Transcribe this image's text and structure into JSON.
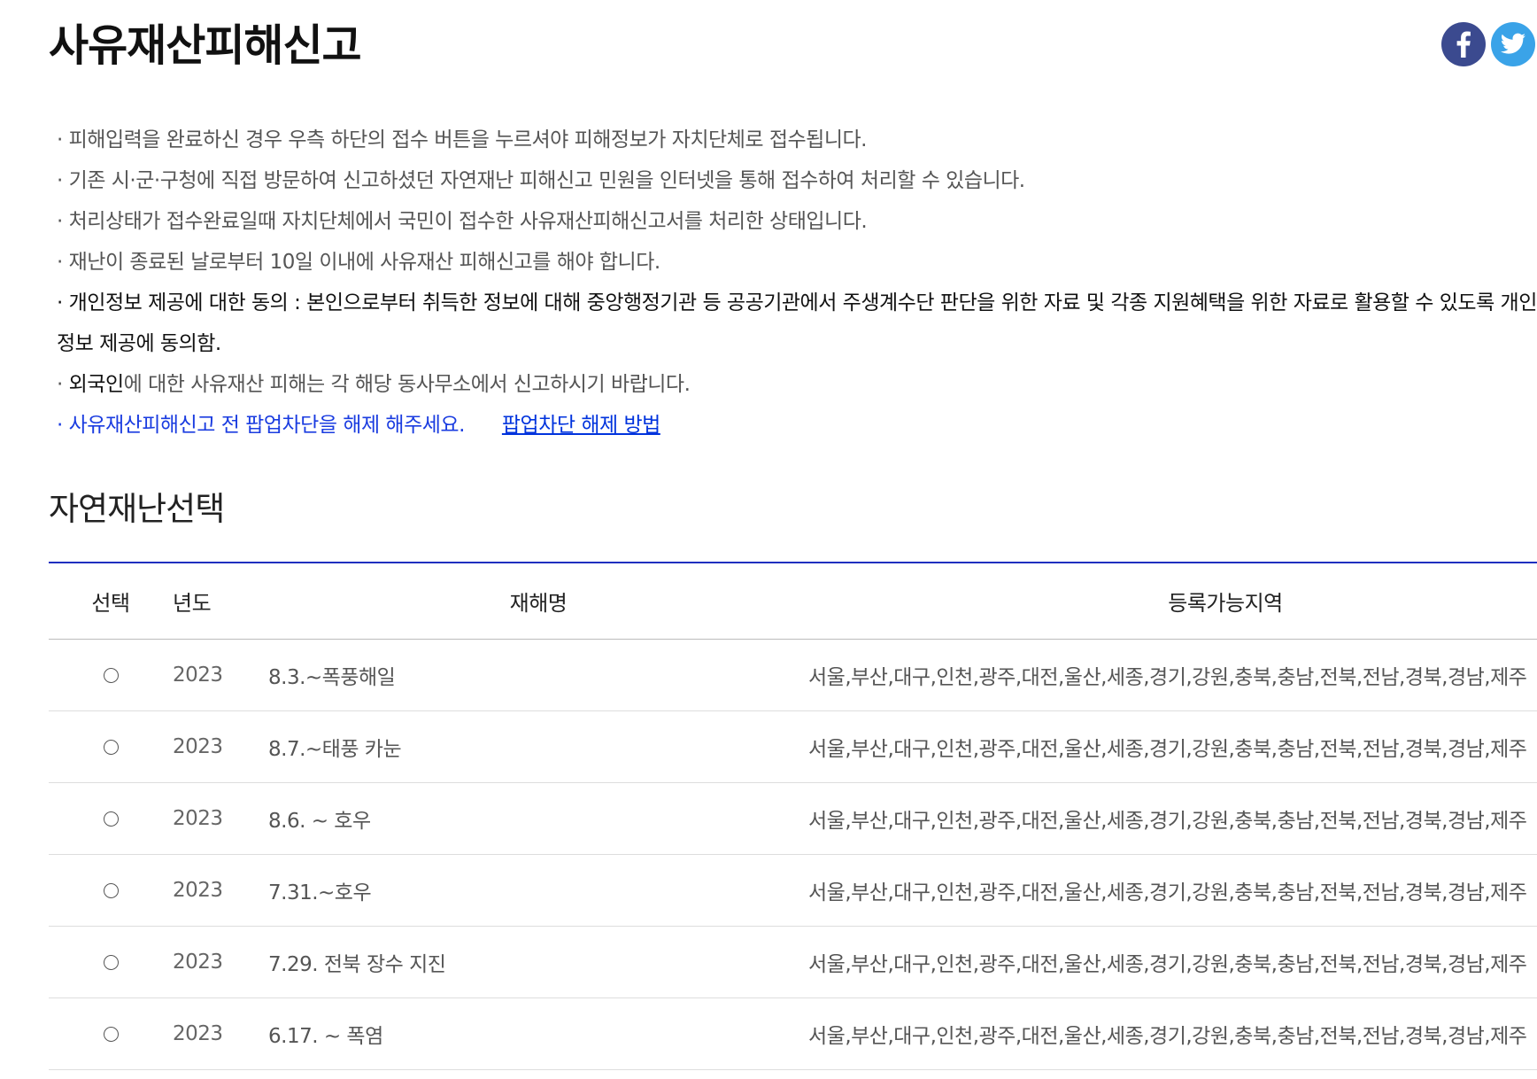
{
  "header": {
    "title": "사유재산피해신고"
  },
  "share": {
    "facebook_icon": "facebook-icon",
    "twitter_icon": "twitter-icon",
    "facebook_color": "#3b4a8f",
    "twitter_color": "#3aa3e8"
  },
  "notices": {
    "n1": "· 피해입력을 완료하신 경우 우측 하단의 접수 버튼을 누르셔야 피해정보가 자치단체로 접수됩니다.",
    "n2": "· 기존 시·군·구청에 직접 방문하여 신고하셨던 자연재난 피해신고 민원을 인터넷을 통해 접수하여 처리할 수 있습니다.",
    "n3": "· 처리상태가 접수완료일때 자치단체에서 국민이 접수한 사유재산피해신고서를 처리한 상태입니다.",
    "n4": "· 재난이 종료된 날로부터 10일 이내에 사유재산 피해신고를 해야 합니다.",
    "n5": "· 개인정보 제공에 대한 동의 : 본인으로부터 취득한 정보에 대해 중앙행정기관 등 공공기관에서 주생계수단 판단을 위한 자료 및 각종 지원혜택을 위한 자료로 활용할 수 있도록 개인정보 제공에 동의함.",
    "n6_prefix": "· ",
    "n6_dark": "외국인",
    "n6_rest": "에 대한 사유재산 피해는 각 해당 동사무소에서 신고하시기 바랍니다.",
    "n7": "· 사유재산피해신고 전 팝업차단을 해제 해주세요.",
    "n7_link": "팝업차단 해제 방법"
  },
  "section": {
    "title": "자연재난선택"
  },
  "table": {
    "headers": {
      "select": "선택",
      "year": "년도",
      "name": "재해명",
      "region": "등록가능지역"
    },
    "rows": [
      {
        "year": "2023",
        "name": "8.3.~폭풍해일",
        "region": "서울,부산,대구,인천,광주,대전,울산,세종,경기,강원,충북,충남,전북,전남,경북,경남,제주"
      },
      {
        "year": "2023",
        "name": "8.7.~태풍 카눈",
        "region": "서울,부산,대구,인천,광주,대전,울산,세종,경기,강원,충북,충남,전북,전남,경북,경남,제주"
      },
      {
        "year": "2023",
        "name": "8.6. ~ 호우",
        "region": "서울,부산,대구,인천,광주,대전,울산,세종,경기,강원,충북,충남,전북,전남,경북,경남,제주"
      },
      {
        "year": "2023",
        "name": "7.31.~호우",
        "region": "서울,부산,대구,인천,광주,대전,울산,세종,경기,강원,충북,충남,전북,전남,경북,경남,제주"
      },
      {
        "year": "2023",
        "name": "7.29. 전북 장수 지진",
        "region": "서울,부산,대구,인천,광주,대전,울산,세종,경기,강원,충북,충남,전북,전남,경북,경남,제주"
      },
      {
        "year": "2023",
        "name": "6.17. ~ 폭염",
        "region": "서울,부산,대구,인천,광주,대전,울산,세종,경기,강원,충북,충남,전북,전남,경북,경남,제주"
      }
    ]
  }
}
